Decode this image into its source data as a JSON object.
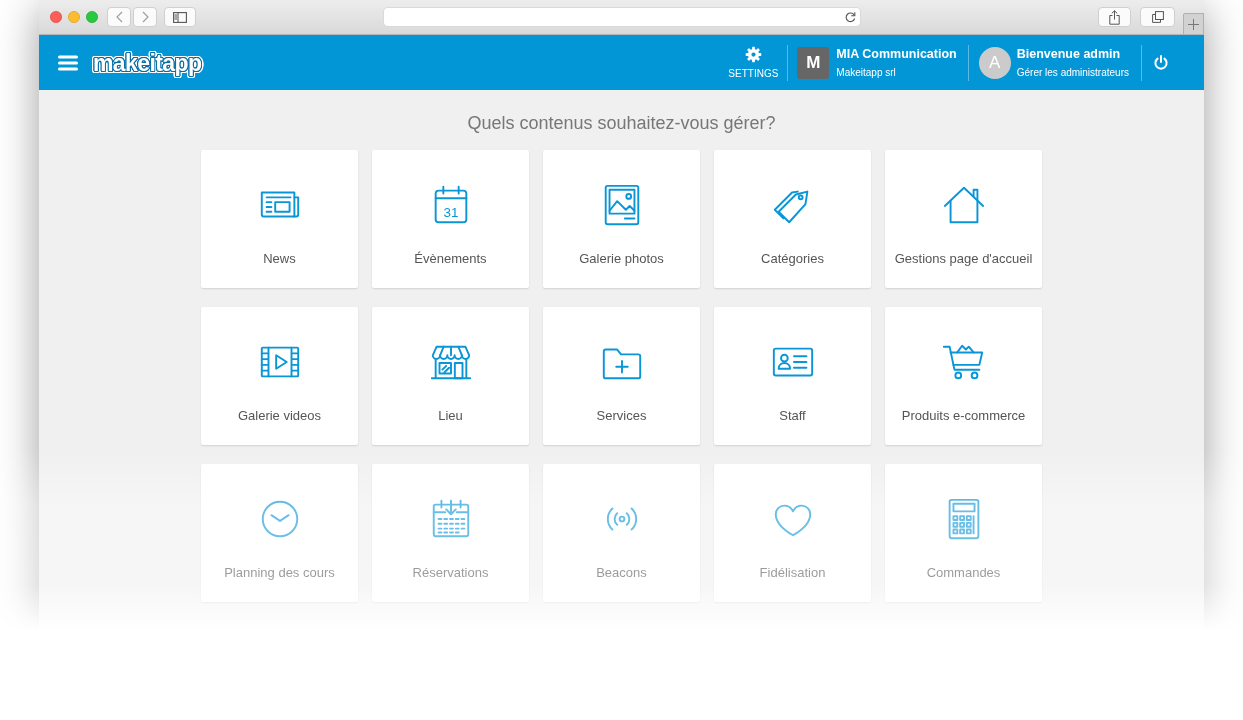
{
  "header": {
    "brand": "makeitapp",
    "settings": {
      "label": "SETTINGS"
    },
    "organization": {
      "initial": "M",
      "name": "MIA Communication",
      "subtitle": "Makeitapp srl"
    },
    "user": {
      "initial": "A",
      "greeting": "Bienvenue admin",
      "link": "Gérer les administrateurs"
    }
  },
  "main": {
    "heading": "Quels contenus souhaitez-vous gérer?",
    "tiles": [
      {
        "kind": "news",
        "label": "News"
      },
      {
        "kind": "calendar",
        "label": "Évènements",
        "icon_text": "31"
      },
      {
        "kind": "photos",
        "label": "Galerie photos"
      },
      {
        "kind": "tags",
        "label": "Catégories"
      },
      {
        "kind": "home",
        "label": "Gestions page d'accueil"
      },
      {
        "kind": "videos",
        "label": "Galerie videos"
      },
      {
        "kind": "store",
        "label": "Lieu"
      },
      {
        "kind": "folder",
        "label": "Services"
      },
      {
        "kind": "staff",
        "label": "Staff"
      },
      {
        "kind": "cart",
        "label": "Produits e-commerce"
      },
      {
        "kind": "clock",
        "label": "Planning des cours"
      },
      {
        "kind": "booking",
        "label": "Réservations"
      },
      {
        "kind": "beacon",
        "label": "Beacons"
      },
      {
        "kind": "heart",
        "label": "Fidélisation"
      },
      {
        "kind": "calculator",
        "label": "Commandes"
      }
    ]
  }
}
